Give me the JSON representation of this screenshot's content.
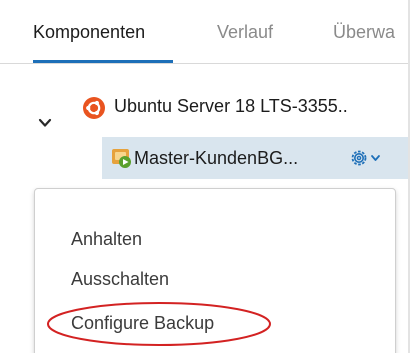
{
  "tabs": [
    {
      "label": "Komponenten",
      "active": true
    },
    {
      "label": "Verlauf",
      "active": false
    },
    {
      "label": "Überwa",
      "active": false
    }
  ],
  "tree": {
    "parent": {
      "label": "Ubuntu Server 18 LTS-3355..",
      "expanded": true,
      "icon": "ubuntu-icon"
    },
    "child": {
      "label": "Master-KundenBG...",
      "icon": "vm-running-icon",
      "selected": true
    }
  },
  "menu": {
    "items": [
      {
        "label": "Anhalten"
      },
      {
        "label": "Ausschalten"
      },
      {
        "label": "Configure Backup",
        "highlighted": true
      }
    ]
  },
  "colors": {
    "accent": "#1d6fb8",
    "selected_row": "#d9e5ee",
    "ubuntu": "#e95420",
    "vm_green": "#5aa02c",
    "annotation": "#d32222"
  }
}
